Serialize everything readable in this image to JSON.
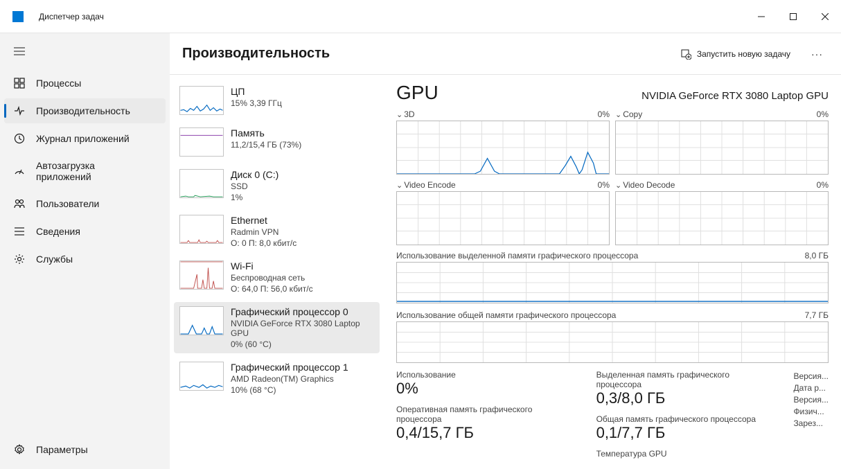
{
  "titlebar": {
    "title": "Диспетчер задач"
  },
  "nav": {
    "items": [
      {
        "label": "Процессы"
      },
      {
        "label": "Производительность"
      },
      {
        "label": "Журнал приложений"
      },
      {
        "label": "Автозагрузка приложений"
      },
      {
        "label": "Пользователи"
      },
      {
        "label": "Сведения"
      },
      {
        "label": "Службы"
      }
    ],
    "settings": "Параметры"
  },
  "contentTitle": "Производительность",
  "runTask": "Запустить новую задачу",
  "resList": [
    {
      "title": "ЦП",
      "sub1": "15% 3,39 ГГц",
      "sub2": ""
    },
    {
      "title": "Память",
      "sub1": "11,2/15,4 ГБ (73%)",
      "sub2": ""
    },
    {
      "title": "Диск 0 (C:)",
      "sub1": "SSD",
      "sub2": "1%"
    },
    {
      "title": "Ethernet",
      "sub1": "Radmin VPN",
      "sub2": "О: 0 П: 8,0 кбит/с"
    },
    {
      "title": "Wi-Fi",
      "sub1": "Беспроводная сеть",
      "sub2": "О: 64,0 П: 56,0 кбит/с"
    },
    {
      "title": "Графический процессор 0",
      "sub1": "NVIDIA GeForce RTX 3080 Laptop GPU",
      "sub2": "0%  (60 °C)"
    },
    {
      "title": "Графический процессор 1",
      "sub1": "AMD Radeon(TM) Graphics",
      "sub2": "10%  (68 °C)"
    }
  ],
  "detail": {
    "big": "GPU",
    "name": "NVIDIA GeForce RTX 3080 Laptop GPU",
    "g1": {
      "label": "3D",
      "pct": "0%"
    },
    "g2": {
      "label": "Copy",
      "pct": "0%"
    },
    "g3": {
      "label": "Video Encode",
      "pct": "0%"
    },
    "g4": {
      "label": "Video Decode",
      "pct": "0%"
    },
    "mem1": {
      "label": "Использование выделенной памяти графического процессора",
      "right": "8,0 ГБ"
    },
    "mem2": {
      "label": "Использование общей памяти графического процессора",
      "right": "7,7 ГБ"
    },
    "stats": {
      "usageL": "Использование",
      "usageV": "0%",
      "sharedL": "Оперативная память графического процессора",
      "sharedV": "0,4/15,7 ГБ",
      "dedL": "Выделенная память графического процессора",
      "dedV": "0,3/8,0 ГБ",
      "totL": "Общая память графического процессора",
      "totV": "0,1/7,7 ГБ",
      "tempL": "Температура GPU"
    },
    "side": [
      "Версия...",
      "Дата р...",
      "Версия...",
      "Физич...",
      "Зарез..."
    ]
  },
  "chart_data": [
    {
      "type": "line",
      "title": "3D",
      "ylim": [
        0,
        100
      ],
      "ylabel": "%",
      "series": [
        {
          "name": "usage",
          "values": [
            0,
            0,
            0,
            0,
            0,
            0,
            0,
            0,
            0,
            0,
            0,
            0,
            0,
            0,
            0,
            0,
            0,
            0,
            0,
            5,
            25,
            5,
            0,
            0,
            0,
            0,
            0,
            0,
            0,
            0,
            0,
            0,
            0,
            0,
            0,
            0,
            0,
            0,
            0,
            0,
            0,
            0,
            15,
            30,
            10,
            0,
            0,
            10,
            40,
            20,
            0,
            0
          ]
        }
      ]
    },
    {
      "type": "line",
      "title": "Copy",
      "ylim": [
        0,
        100
      ],
      "series": [
        {
          "name": "usage",
          "values": [
            0,
            0,
            0,
            0,
            0,
            0,
            0,
            0,
            0,
            0
          ]
        }
      ]
    },
    {
      "type": "line",
      "title": "Video Encode",
      "ylim": [
        0,
        100
      ],
      "series": [
        {
          "name": "usage",
          "values": [
            0,
            0,
            0,
            0,
            0,
            0,
            0,
            0,
            0,
            0
          ]
        }
      ]
    },
    {
      "type": "line",
      "title": "Video Decode",
      "ylim": [
        0,
        100
      ],
      "series": [
        {
          "name": "usage",
          "values": [
            0,
            0,
            0,
            0,
            0,
            0,
            0,
            0,
            0,
            0
          ]
        }
      ]
    },
    {
      "type": "line",
      "title": "Dedicated GPU memory usage",
      "ylim": [
        0,
        8
      ],
      "ylabel": "ГБ",
      "series": [
        {
          "name": "dedicated",
          "values": [
            0.3,
            0.3,
            0.3,
            0.3,
            0.3,
            0.3,
            0.3,
            0.3,
            0.3,
            0.3
          ]
        }
      ]
    },
    {
      "type": "line",
      "title": "Shared GPU memory usage",
      "ylim": [
        0,
        7.7
      ],
      "ylabel": "ГБ",
      "series": [
        {
          "name": "shared",
          "values": [
            0.1,
            0.1,
            0.1,
            0.1,
            0.1,
            0.1,
            0.1,
            0.1,
            0.1,
            0.1
          ]
        }
      ]
    }
  ]
}
